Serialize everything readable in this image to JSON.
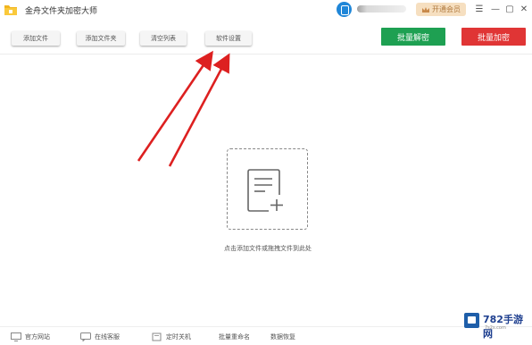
{
  "app": {
    "title": "金舟文件夹加密大师"
  },
  "titlebar": {
    "vip_label": "开通会员"
  },
  "toolbar": {
    "add_file": "添加文件",
    "add_folder": "添加文件夹",
    "clear_list": "清空列表",
    "settings": "软件设置",
    "batch_decrypt": "批量解密",
    "batch_encrypt": "批量加密"
  },
  "main": {
    "drop_hint": "点击添加文件或拖拽文件到此处"
  },
  "footer": {
    "website": "官方网站",
    "support": "在线客服",
    "timed_shutdown": "定时关机",
    "batch_rename": "批量重命名",
    "data_recovery": "数据恢复"
  },
  "watermark": {
    "name": "782手游网",
    "url": "7s2s.com"
  },
  "colors": {
    "decrypt_green": "#1ea052",
    "encrypt_red": "#e03535",
    "accent_blue": "#1f86d8",
    "arrow_red": "#dd2020"
  }
}
